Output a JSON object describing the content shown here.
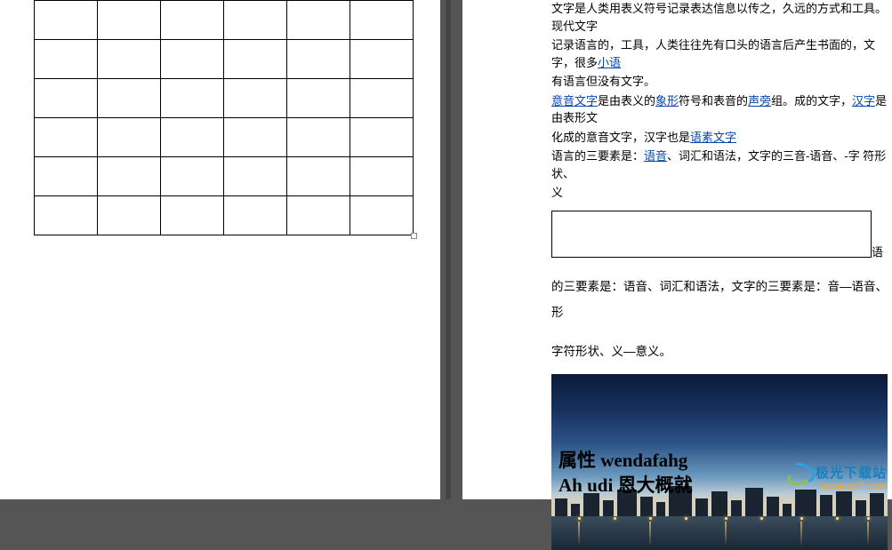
{
  "leftPage": {
    "table": {
      "rows": 6,
      "cols": 6
    }
  },
  "rightPage": {
    "p1_a": "文字是人类用表义符号记录表达信息以传之，久远的方式和工具。现代文字",
    "p1_b": "记录语言的，工具，人类往往先有口头的语言后产生书面的，文字，很多",
    "link1": "小语",
    "p2": "有语言但没有文字。",
    "link2": "意音文字",
    "p3_a": "是由表义的",
    "link3": "象形",
    "p3_b": "符号和表音的",
    "link4": "声旁",
    "p3_c": "组。成的文字，",
    "link5": "汉字",
    "p3_d": "是由表形文",
    "p4_a": "化成的意音文字，汉字也是",
    "link6": "语素文字",
    "p5_a": "语言的三要素是：",
    "link7": "语音",
    "p5_b": "、词汇和语法，文字的三音-语音、-字 符形状、",
    "p5_c": "义",
    "afterFrame": "语",
    "spaced1": "的三要素是：语音、词汇和语法，文字的三要素是：音—语音、形",
    "spaced2": "字符形状、义—意义。",
    "bigText1": "属性 wendafahg",
    "bigText2": "Ah udi 恩大概就"
  },
  "watermark": {
    "name": "极光下载站",
    "url": "www.xz7.com"
  }
}
